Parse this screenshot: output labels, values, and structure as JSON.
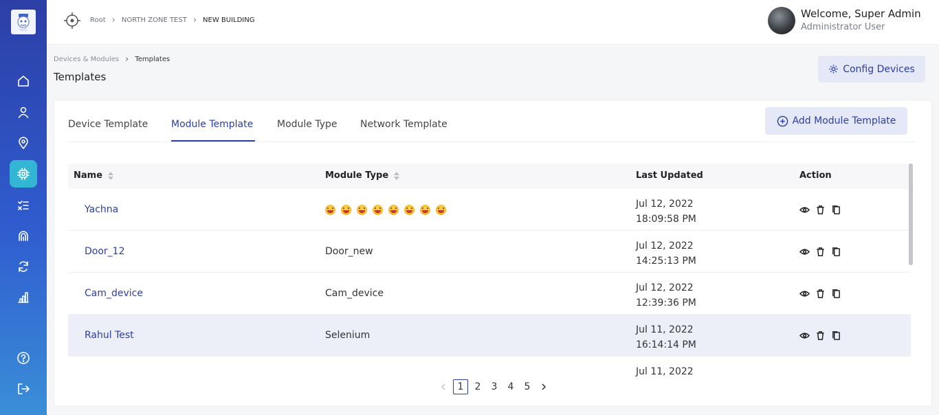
{
  "header": {
    "breadcrumbs": [
      "Root",
      "NORTH ZONE TEST",
      "NEW BUILDING"
    ],
    "welcome": "Welcome, Super Admin",
    "role": "Administrator User"
  },
  "sidebar": {
    "items": [
      {
        "icon": "home-icon"
      },
      {
        "icon": "user-icon"
      },
      {
        "icon": "location-icon"
      },
      {
        "icon": "chip-icon",
        "active": true
      },
      {
        "icon": "checklist-icon"
      },
      {
        "icon": "fingerprint-icon"
      },
      {
        "icon": "sync-icon"
      },
      {
        "icon": "bar-chart-icon"
      },
      {
        "icon": "help-icon"
      },
      {
        "icon": "logout-icon"
      }
    ]
  },
  "page": {
    "breadcrumb": [
      "Devices & Modules",
      "Templates"
    ],
    "title": "Templates",
    "config_button": "Config Devices"
  },
  "tabs": [
    {
      "label": "Device Template"
    },
    {
      "label": "Module Template",
      "active": true
    },
    {
      "label": "Module Type"
    },
    {
      "label": "Network Template"
    }
  ],
  "add_button": "Add Module Template",
  "table": {
    "columns": [
      "Name",
      "Module Type",
      "Last Updated",
      "Action"
    ],
    "rows": [
      {
        "name": "Yachna",
        "type": "",
        "emoji_count": 8,
        "date": "Jul 12, 2022",
        "time": "18:09:58 PM"
      },
      {
        "name": "Door_12",
        "type": "Door_new",
        "date": "Jul 12, 2022",
        "time": "14:25:13 PM"
      },
      {
        "name": "Cam_device",
        "type": "Cam_device",
        "date": "Jul 12, 2022",
        "time": "12:39:36 PM"
      },
      {
        "name": "Rahul Test",
        "type": "Selenium",
        "date": "Jul 11, 2022",
        "time": "16:14:14 PM",
        "highlighted": true
      },
      {
        "name": "",
        "type": "",
        "date": "Jul 11, 2022",
        "time": ""
      }
    ]
  },
  "pagination": {
    "pages": [
      "1",
      "2",
      "3",
      "4",
      "5"
    ],
    "current": "1"
  },
  "colors": {
    "accent": "#2b3ea3",
    "sidebar_active": "#33b6d4"
  }
}
